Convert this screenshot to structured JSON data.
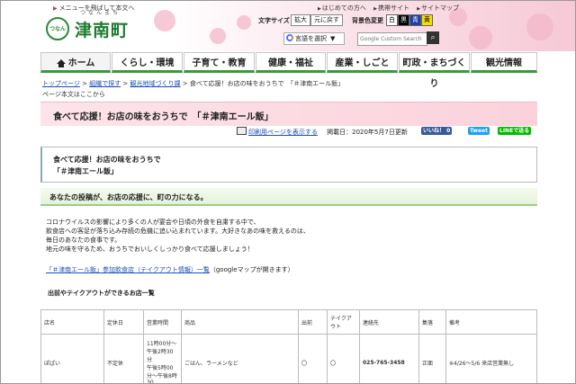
{
  "header": {
    "skip_link": "メニューを飛ばして本文へ",
    "logo_ruby": "つなんまち",
    "logo_text": "津南町",
    "logo_mark": "つなん",
    "top_links": [
      "はじめての方へ",
      "携帯サイト",
      "サイトマップ"
    ],
    "font_size_label": "文字サイズ",
    "font_size_buttons": [
      "拡大",
      "元に戻す"
    ],
    "bg_color_label": "背景色変更",
    "bg_color_buttons": [
      {
        "label": "白",
        "bg": "#ffffff",
        "fg": "#000000"
      },
      {
        "label": "黒",
        "bg": "#000000",
        "fg": "#ffffff"
      },
      {
        "label": "青",
        "bg": "#1f3ea8",
        "fg": "#ffffff"
      },
      {
        "label": "黄",
        "bg": "#f5e000",
        "fg": "#000000"
      }
    ],
    "translate_label": "言語を選択",
    "search_placeholder": "Google Custom Search"
  },
  "nav": {
    "items": [
      "ホーム",
      "くらし・環境",
      "子育て・教育",
      "健康・福祉",
      "産業・しごと",
      "町政・まちづくり",
      "観光情報"
    ]
  },
  "breadcrumb": {
    "items": [
      "トップページ",
      "組織で探す",
      "観光地域づくり課"
    ],
    "current": "食べて応援！お店の味をおうちで　「＃津南エール飯」",
    "here_text": "ページ本文はここから"
  },
  "page": {
    "title": "食べて応援！お店の味をおうちで　「＃津南エール飯」",
    "print_link": "印刷用ページを表示する",
    "posted": "掲載日：2020年5月7日更新",
    "share_buttons": [
      {
        "label": "いいね！ 0",
        "color": "#3b5998"
      },
      {
        "label": "Tweet",
        "color": "#1da1f2"
      },
      {
        "label": "LINEで送る",
        "color": "#00b900"
      }
    ],
    "box_line1": "食べて応援！お店の味をおうちで",
    "box_line2": "「＃津南エール飯」",
    "section_heading": "あなたの投稿が、お店の応援に、町の力になる。",
    "paragraph": [
      "コロナウイルスの影響により多くの人が宴会や日頃の外食を自粛する中で、",
      "飲食店への客足が落ち込み存続の危機に追い込まれています。大好きなあの味を救えるのは、",
      "毎日のあなたの食事です。",
      "地元の味を守るため、おうちでおいしくしっかり食べて応援しましょう！"
    ],
    "map_link": "「＃津南エール飯」参加飲食店（テイクアウト情報）一覧",
    "map_note": "（googleマップが開きます）",
    "list_heading": "出前やテイクアウトができるお店一覧"
  },
  "table": {
    "headers": [
      "店名",
      "定休日",
      "営業時間",
      "商品",
      "出前",
      "テイクアウト",
      "連絡先",
      "集落",
      "備考"
    ],
    "rows": [
      [
        "ぽぱい",
        "不定休",
        "11時00分～午後2時30分\n午後5時00分～午後8時30",
        "ごはん、ラーメンなど",
        "〇",
        "〇",
        "025-765-3458",
        "正面",
        "※4/26～5/6 来店営業無し"
      ]
    ]
  }
}
